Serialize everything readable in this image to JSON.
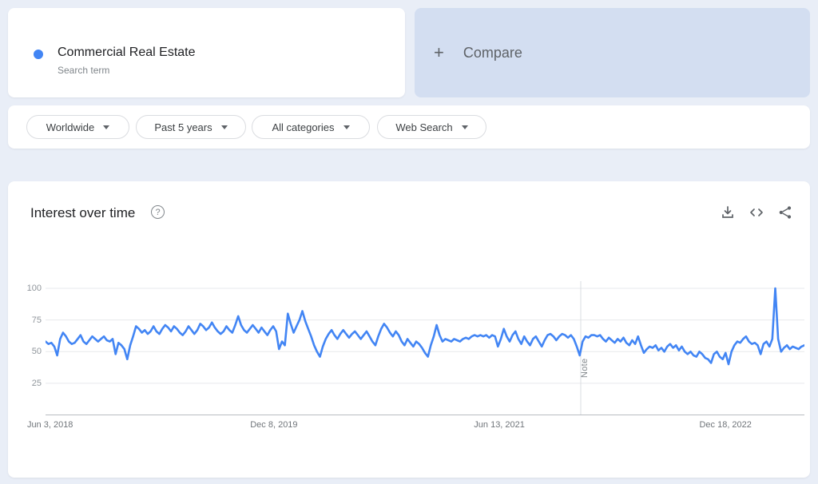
{
  "term_card": {
    "title": "Commercial Real Estate",
    "subtitle": "Search term"
  },
  "compare_card": {
    "plus": "+",
    "label": "Compare"
  },
  "filters": [
    "Worldwide",
    "Past 5 years",
    "All categories",
    "Web Search"
  ],
  "chart_header": {
    "title": "Interest over time",
    "help": "?"
  },
  "colors": {
    "accent_blue": "#4285f4",
    "page_bg": "#e9eef7",
    "compare_bg": "#d3def1",
    "text_primary": "#202124",
    "text_secondary": "#5f6368",
    "tick_gray": "#90969c",
    "grid_line": "#e7e9ec",
    "note_line": "#dadce0",
    "axis_line": "#b9bdc2"
  },
  "chart_data": {
    "type": "line",
    "title": "Interest over time",
    "xlabel": "",
    "ylabel": "",
    "ylim": [
      0,
      106
    ],
    "grid": true,
    "legend_position": "none",
    "y_ticks": [
      100,
      75,
      50,
      25
    ],
    "x_ticks": [
      {
        "label": "Jun 3, 2018",
        "pos": 0.006
      },
      {
        "label": "Dec 8, 2019",
        "pos": 0.301
      },
      {
        "label": "Jun 13, 2021",
        "pos": 0.598
      },
      {
        "label": "Dec 18, 2022",
        "pos": 0.896
      }
    ],
    "note": {
      "label": "Note",
      "pos": 0.7053
    },
    "series": [
      {
        "name": "Commercial Real Estate",
        "color": "#4285f4",
        "values": [
          58,
          56,
          57,
          54,
          47,
          60,
          65,
          62,
          58,
          56,
          57,
          60,
          63,
          58,
          56,
          59,
          62,
          60,
          58,
          60,
          62,
          59,
          58,
          60,
          48,
          57,
          55,
          52,
          44,
          55,
          62,
          70,
          68,
          65,
          67,
          64,
          66,
          70,
          66,
          64,
          68,
          71,
          69,
          66,
          70,
          68,
          65,
          63,
          66,
          70,
          67,
          64,
          67,
          72,
          70,
          67,
          69,
          73,
          69,
          66,
          64,
          66,
          70,
          67,
          65,
          71,
          78,
          71,
          67,
          65,
          68,
          71,
          68,
          65,
          69,
          66,
          63,
          67,
          70,
          66,
          52,
          58,
          55,
          80,
          72,
          65,
          70,
          75,
          82,
          74,
          68,
          62,
          55,
          50,
          46,
          54,
          60,
          64,
          67,
          63,
          60,
          64,
          67,
          64,
          61,
          64,
          66,
          63,
          60,
          63,
          66,
          62,
          58,
          55,
          62,
          68,
          72,
          69,
          65,
          62,
          66,
          63,
          58,
          55,
          60,
          57,
          54,
          58,
          56,
          53,
          49,
          46,
          55,
          62,
          71,
          63,
          58,
          60,
          59,
          58,
          60,
          59,
          58,
          60,
          61,
          60,
          62,
          63,
          62,
          63,
          62,
          63,
          61,
          63,
          62,
          54,
          60,
          68,
          62,
          58,
          63,
          66,
          60,
          56,
          62,
          58,
          55,
          60,
          62,
          58,
          54,
          59,
          63,
          64,
          62,
          59,
          62,
          64,
          63,
          61,
          63,
          60,
          54,
          47,
          58,
          62,
          61,
          63,
          63,
          62,
          63,
          60,
          58,
          61,
          59,
          57,
          60,
          58,
          61,
          57,
          55,
          59,
          56,
          62,
          55,
          49,
          52,
          54,
          53,
          55,
          51,
          53,
          50,
          54,
          56,
          53,
          55,
          51,
          54,
          50,
          48,
          50,
          47,
          46,
          50,
          48,
          45,
          44,
          41,
          48,
          50,
          46,
          44,
          49,
          40,
          50,
          55,
          58,
          57,
          60,
          62,
          58,
          56,
          57,
          55,
          48,
          56,
          58,
          54,
          60,
          100,
          60,
          50,
          53,
          55,
          52,
          54,
          53,
          52,
          54,
          55
        ]
      }
    ]
  }
}
